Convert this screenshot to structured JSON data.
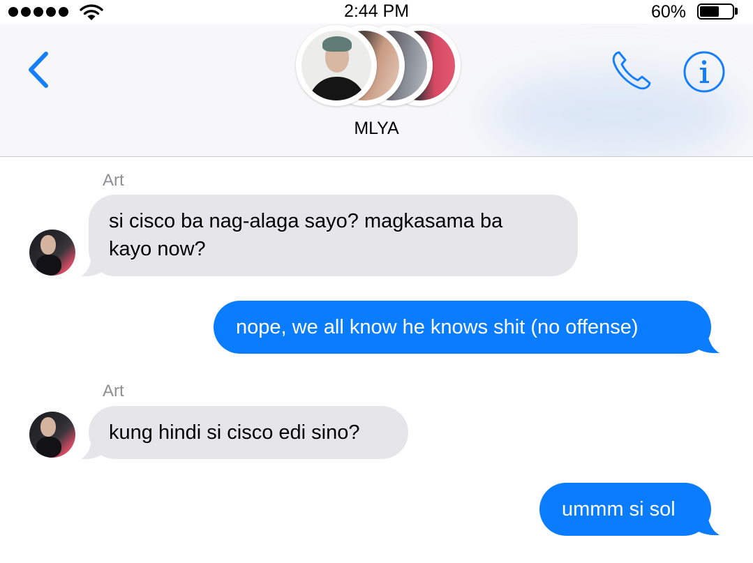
{
  "status_bar": {
    "signal_bars": 5,
    "wifi_icon": "wifi-icon",
    "time": "2:44 PM",
    "battery_percent_text": "60%",
    "battery_level": 0.6
  },
  "header": {
    "back_icon": "chevron-left-icon",
    "call_icon": "phone-icon",
    "info_icon": "info-icon",
    "group_name": "MLYA",
    "accent_color": "#157EFB"
  },
  "messages": [
    {
      "direction": "incoming",
      "sender": "Art",
      "lines": [
        "si cisco ba nag-alaga sayo? magkasama ba",
        "kayo now?"
      ]
    },
    {
      "direction": "outgoing",
      "lines": [
        "nope, we all know he knows shit (no offense)"
      ]
    },
    {
      "direction": "incoming",
      "sender": "Art",
      "lines": [
        "kung hindi si cisco edi sino?"
      ]
    },
    {
      "direction": "outgoing",
      "lines": [
        "ummm si sol"
      ]
    }
  ],
  "colors": {
    "incoming_bubble": "#E5E5EA",
    "outgoing_bubble": "#0A7CFF",
    "sender_label": "#8E8E93"
  }
}
